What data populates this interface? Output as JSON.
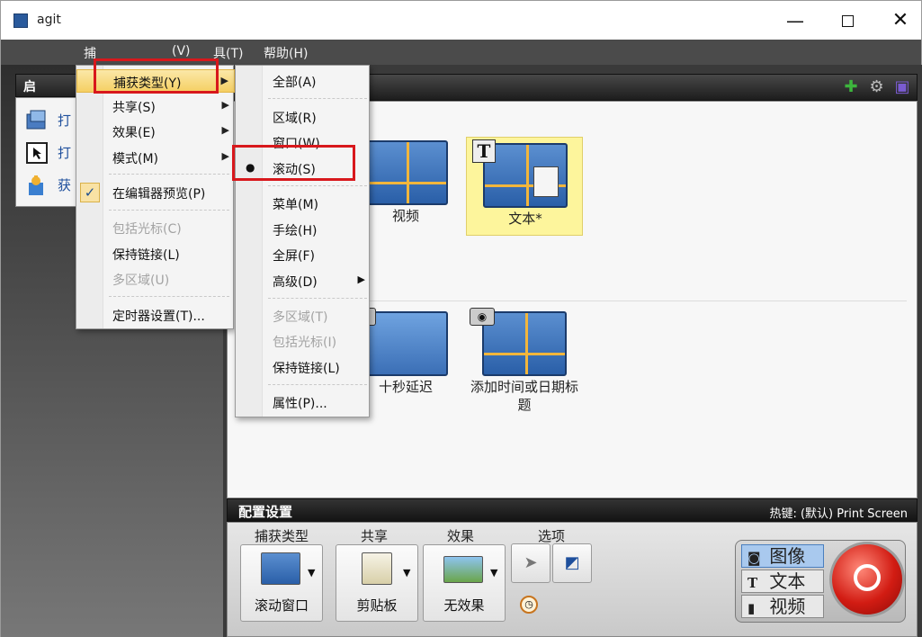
{
  "window": {
    "title": "agit",
    "min_glyph": "—",
    "close_glyph": "✕"
  },
  "menubar": {
    "items": [
      "捕",
      "(V)",
      "具(T)",
      "帮助(H)"
    ]
  },
  "left_panel": {
    "header": "启",
    "rows": [
      {
        "label": "打",
        "icon": "profile-icon"
      },
      {
        "label": "打",
        "icon": "cursor-window-icon"
      },
      {
        "label": "获",
        "icon": "puzzle-icon"
      }
    ]
  },
  "main": {
    "presets": [
      {
        "label": "视频",
        "icon": "video-preset-icon"
      },
      {
        "label": "文本*",
        "icon": "text-preset-icon",
        "selected": true
      },
      {
        "label": "十秒延迟",
        "icon": "delay-preset-icon"
      },
      {
        "label": "添加时间或日期标题",
        "icon": "timestamp-preset-icon"
      }
    ],
    "header_icons": [
      "plus-icon",
      "properties-icon",
      "save-icon"
    ]
  },
  "menu1": {
    "items": [
      {
        "label": "捕获类型(Y)",
        "submenu": true,
        "highlighted": true
      },
      {
        "label": "共享(S)",
        "submenu": true
      },
      {
        "label": "效果(E)",
        "submenu": true
      },
      {
        "label": "模式(M)",
        "submenu": true
      },
      {
        "label": "在编辑器预览(P)",
        "checked": true
      },
      {
        "label": "包括光标(C)",
        "disabled": true
      },
      {
        "label": "保持链接(L)"
      },
      {
        "label": "多区域(U)",
        "disabled": true
      },
      {
        "label": "定时器设置(T)..."
      }
    ],
    "check_glyph": "✓"
  },
  "menu2": {
    "items": [
      {
        "label": "全部(A)"
      },
      {
        "label": "区域(R)"
      },
      {
        "label": "窗口(W)"
      },
      {
        "label": "滚动(S)",
        "selected": true
      },
      {
        "label": "菜单(M)"
      },
      {
        "label": "手绘(H)"
      },
      {
        "label": "全屏(F)"
      },
      {
        "label": "高级(D)",
        "submenu": true
      },
      {
        "label": "多区域(T)",
        "disabled": true
      },
      {
        "label": "包括光标(I)",
        "disabled": true
      },
      {
        "label": "保持链接(L)"
      },
      {
        "label": "属性(P)..."
      }
    ],
    "radio_glyph": "●"
  },
  "config": {
    "title": "配置设置",
    "hotkey": "热键: (默认) Print Screen",
    "columns": {
      "capture_type": {
        "label": "捕获类型",
        "value": "滚动窗口"
      },
      "share": {
        "label": "共享",
        "value": "剪贴板"
      },
      "effects": {
        "label": "效果",
        "value": "无效果"
      },
      "options": {
        "label": "选项"
      }
    },
    "modes": [
      {
        "label": "图像",
        "icon": "camera-icon",
        "active": true
      },
      {
        "label": "文本",
        "icon": "text-icon"
      },
      {
        "label": "视频",
        "icon": "film-icon"
      }
    ]
  },
  "colors": {
    "highlight_box": "#d8181c",
    "selected_preset_bg": "#fdf59c",
    "menu_highlight": "#f5cf63"
  }
}
